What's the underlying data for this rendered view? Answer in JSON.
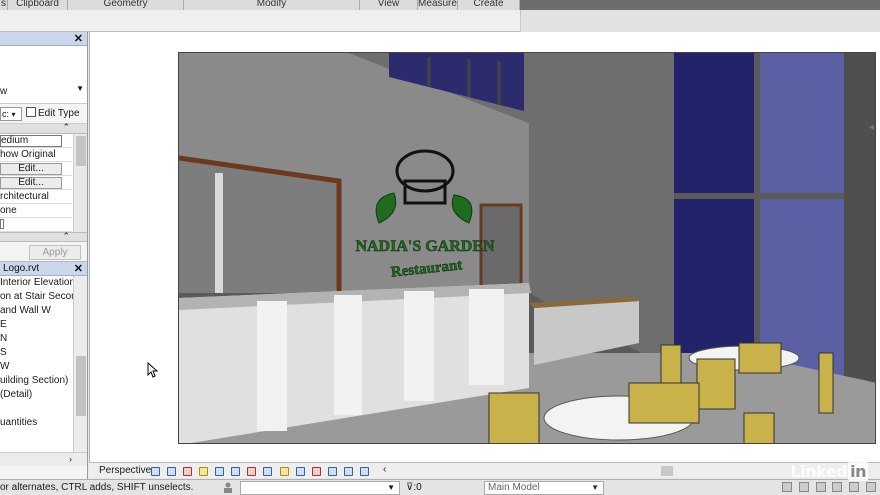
{
  "ribbon": {
    "panels": [
      "s",
      "Clipboard",
      "Geometry",
      "Modify",
      "View",
      "Measure",
      "Create"
    ]
  },
  "properties": {
    "close": "✕",
    "type_label": "w",
    "selector_value": "c:",
    "edit_type": "Edit Type",
    "rows": [
      "edium",
      "how Original",
      "Edit...",
      "Edit...",
      "rchitectural",
      "one"
    ],
    "apply": "Apply"
  },
  "browser": {
    "title": "Logo.rvt",
    "close": "✕",
    "items": [
      "Interior Elevation",
      "on at Stair Second",
      "and Wall W",
      "E",
      "N",
      "S",
      "W",
      "uilding Section)",
      "(Detail)",
      "",
      "uantities"
    ]
  },
  "view": {
    "sign_line1": "NADIA'S GARDEN",
    "sign_line2": "Restaurant"
  },
  "view_control": {
    "mode": "Perspective",
    "left_arrow": "‹"
  },
  "status": {
    "message": "or alternates, CTRL adds, SHIFT unselects.",
    "zero": ":0",
    "model": "Main Model"
  },
  "watermark": {
    "brand": "Linked",
    "in": "in"
  },
  "colors": {
    "panel_header": "#c9d7ea",
    "sign_green": "#1f6b1f",
    "window_blue": "#2a2a7a"
  }
}
